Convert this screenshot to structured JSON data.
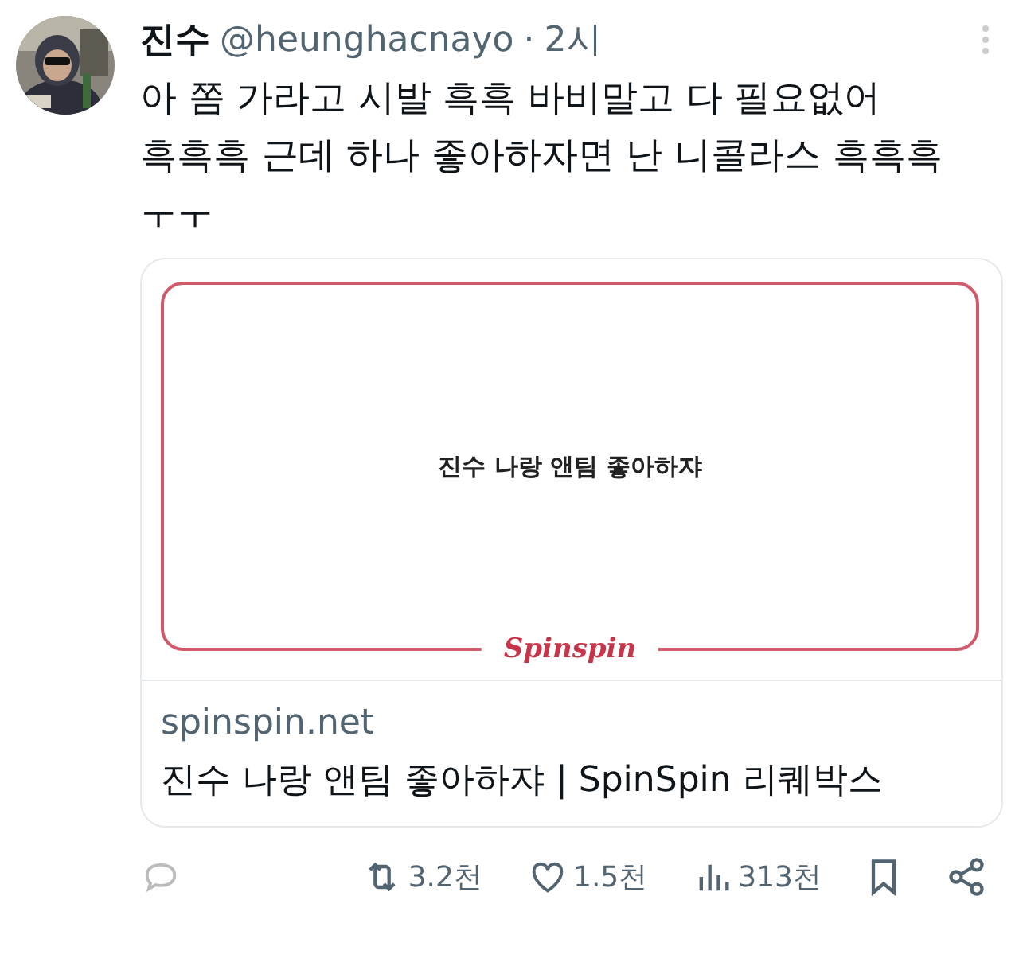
{
  "author": {
    "name": "진수",
    "handle": "@heunghacnayo",
    "separator": "·",
    "time": "2시"
  },
  "body": [
    "아 쫌 가라고 시발 흑흑 바비말고 다 필요없어",
    "흑흑흑 근데 하나 좋아하자면 난 니콜라스 흑흑흑",
    "ㅜㅜ"
  ],
  "card": {
    "image_text": "진수 나랑 앤팀 좋아하쟈",
    "logo": "Spinspin",
    "domain": "spinspin.net",
    "title": "진수 나랑 앤팀 좋아하쟈 | SpinSpin 리퀘박스"
  },
  "actions": [
    {
      "kind": "reply"
    },
    {
      "kind": "retweet",
      "count": "3.2천"
    },
    {
      "kind": "like",
      "count": "1.5천"
    },
    {
      "kind": "views",
      "count": "313천"
    },
    {
      "kind": "bookmark"
    },
    {
      "kind": "share"
    }
  ]
}
